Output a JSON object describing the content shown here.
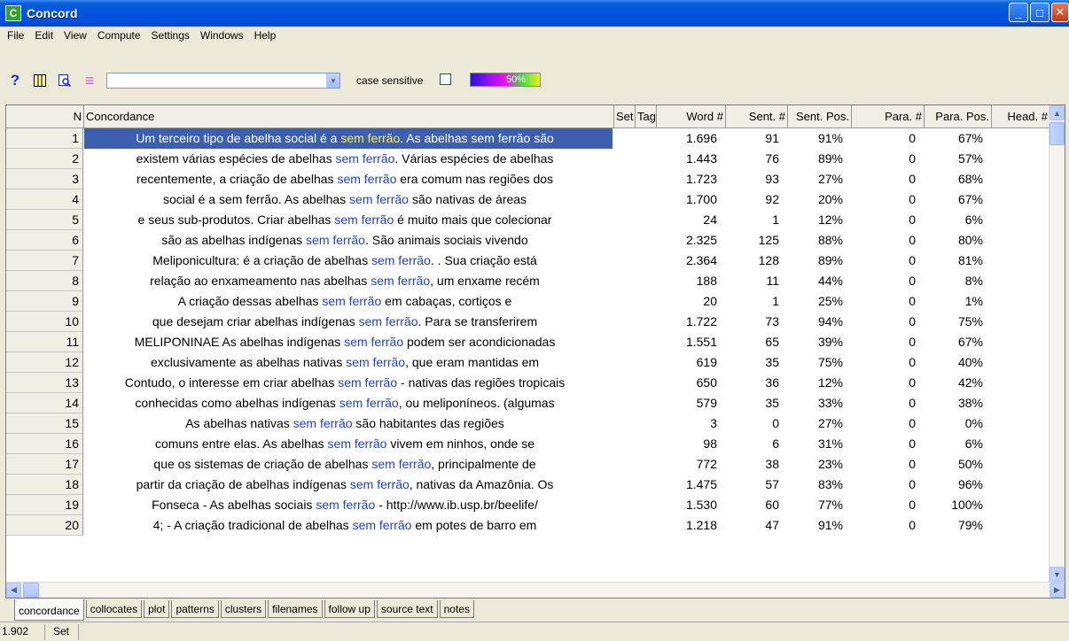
{
  "window": {
    "title": "Concord",
    "app_icon": "C"
  },
  "menu": [
    "File",
    "Edit",
    "View",
    "Compute",
    "Settings",
    "Windows",
    "Help"
  ],
  "toolbar": {
    "search_value": "",
    "case_sensitive_label": "case sensitive",
    "case_sensitive_checked": false,
    "progress_text": "50%",
    "progress_fraction": 0.5
  },
  "table": {
    "headers": [
      "N",
      "Concordance",
      "Set",
      "Tag",
      "Word #",
      "Sent. #",
      "Sent. Pos.",
      "Para. #",
      "Para. Pos.",
      "Head. #"
    ],
    "rows": [
      {
        "n": "1",
        "left": "Um terceiro tipo de abelha social é a ",
        "hit": "sem ferrão",
        "right": ". As abelhas sem ferrão são",
        "word": "1.696",
        "sent": "91",
        "sentpos": "91%",
        "para": "0",
        "parapos": "67%",
        "selected": true
      },
      {
        "n": "2",
        "left": "existem várias espécies de abelhas ",
        "hit": "sem ferrão",
        "right": ". Várias espécies de abelhas",
        "word": "1.443",
        "sent": "76",
        "sentpos": "89%",
        "para": "0",
        "parapos": "57%"
      },
      {
        "n": "3",
        "left": "recentemente, a criação de abelhas ",
        "hit": "sem ferrão",
        "right": " era comum nas regiões dos",
        "word": "1.723",
        "sent": "93",
        "sentpos": "27%",
        "para": "0",
        "parapos": "68%"
      },
      {
        "n": "4",
        "left": "social é a sem ferrão. As abelhas ",
        "hit": "sem ferrão",
        "right": " são nativas de áreas",
        "word": "1.700",
        "sent": "92",
        "sentpos": "20%",
        "para": "0",
        "parapos": "67%"
      },
      {
        "n": "5",
        "left": "e seus sub-produtos. Criar abelhas ",
        "hit": "sem ferrão",
        "right": " é muito mais que colecionar",
        "word": "24",
        "sent": "1",
        "sentpos": "12%",
        "para": "0",
        "parapos": "6%"
      },
      {
        "n": "6",
        "left": "são as abelhas indígenas ",
        "hit": "sem ferrão",
        "right": ". São animais sociais vivendo",
        "word": "2.325",
        "sent": "125",
        "sentpos": "88%",
        "para": "0",
        "parapos": "80%"
      },
      {
        "n": "7",
        "left": "Meliponicultura: é a criação de abelhas ",
        "hit": "sem ferrão",
        "right": ". . Sua criação está",
        "word": "2.364",
        "sent": "128",
        "sentpos": "89%",
        "para": "0",
        "parapos": "81%"
      },
      {
        "n": "8",
        "left": "relação ao enxameamento nas abelhas ",
        "hit": "sem ferrão",
        "right": ", um enxame recém",
        "word": "188",
        "sent": "11",
        "sentpos": "44%",
        "para": "0",
        "parapos": "8%"
      },
      {
        "n": "9",
        "left": "A criação dessas abelhas ",
        "hit": "sem ferrão",
        "right": " em cabaças, cortiços e",
        "word": "20",
        "sent": "1",
        "sentpos": "25%",
        "para": "0",
        "parapos": "1%"
      },
      {
        "n": "10",
        "left": "que desejam criar abelhas indígenas ",
        "hit": "sem ferrão",
        "right": ". Para se transferirem",
        "word": "1.722",
        "sent": "73",
        "sentpos": "94%",
        "para": "0",
        "parapos": "75%"
      },
      {
        "n": "11",
        "left": "MELIPONINAE As abelhas indígenas ",
        "hit": "sem ferrão",
        "right": " podem ser acondicionadas",
        "word": "1.551",
        "sent": "65",
        "sentpos": "39%",
        "para": "0",
        "parapos": "67%"
      },
      {
        "n": "12",
        "left": "exclusivamente as abelhas nativas ",
        "hit": "sem ferrão",
        "right": ", que eram mantidas em",
        "word": "619",
        "sent": "35",
        "sentpos": "75%",
        "para": "0",
        "parapos": "40%"
      },
      {
        "n": "13",
        "left": "Contudo, o interesse em criar abelhas ",
        "hit": "sem ferrão",
        "right": " - nativas das regiões tropicais",
        "word": "650",
        "sent": "36",
        "sentpos": "12%",
        "para": "0",
        "parapos": "42%"
      },
      {
        "n": "14",
        "left": "conhecidas como abelhas indígenas ",
        "hit": "sem ferrão",
        "right": ", ou meliponíneos. (algumas",
        "word": "579",
        "sent": "35",
        "sentpos": "33%",
        "para": "0",
        "parapos": "38%"
      },
      {
        "n": "15",
        "left": "As abelhas nativas ",
        "hit": "sem ferrão",
        "right": " são habitantes das regiões",
        "word": "3",
        "sent": "0",
        "sentpos": "27%",
        "para": "0",
        "parapos": "0%"
      },
      {
        "n": "16",
        "left": "comuns entre elas. As abelhas ",
        "hit": "sem ferrão",
        "right": " vivem em ninhos, onde se",
        "word": "98",
        "sent": "6",
        "sentpos": "31%",
        "para": "0",
        "parapos": "6%"
      },
      {
        "n": "17",
        "left": "que os sistemas de criação de abelhas ",
        "hit": "sem ferrão",
        "right": ", principalmente de",
        "word": "772",
        "sent": "38",
        "sentpos": "23%",
        "para": "0",
        "parapos": "50%"
      },
      {
        "n": "18",
        "left": "partir da criação de abelhas indígenas ",
        "hit": "sem ferrão",
        "right": ", nativas da Amazônia. Os",
        "word": "1.475",
        "sent": "57",
        "sentpos": "83%",
        "para": "0",
        "parapos": "96%"
      },
      {
        "n": "19",
        "left": "Fonseca - As abelhas sociais ",
        "hit": "sem ferrão",
        "right": " - http://www.ib.usp.br/beelife/",
        "word": "1.530",
        "sent": "60",
        "sentpos": "77%",
        "para": "0",
        "parapos": "100%"
      },
      {
        "n": "20",
        "left": "4; - A criação tradicional de abelhas ",
        "hit": "sem ferrão",
        "right": " em potes de barro em",
        "word": "1.218",
        "sent": "47",
        "sentpos": "91%",
        "para": "0",
        "parapos": "79%"
      }
    ]
  },
  "tabs": [
    "concordance",
    "collocates",
    "plot",
    "patterns",
    "clusters",
    "filenames",
    "follow up",
    "source text",
    "notes"
  ],
  "active_tab": "concordance",
  "status": {
    "count": "1.902",
    "set_label": "Set"
  },
  "colors": {
    "hit": "#1e3fd8",
    "selection": "#3d5fb0",
    "titlebar": "#0054e3"
  },
  "icons": {
    "help": "help-icon",
    "columns": "columns-icon",
    "search": "search-icon",
    "lines": "lines-icon",
    "minimize": "minimize-icon",
    "maximize": "maximize-icon",
    "close": "close-icon"
  }
}
